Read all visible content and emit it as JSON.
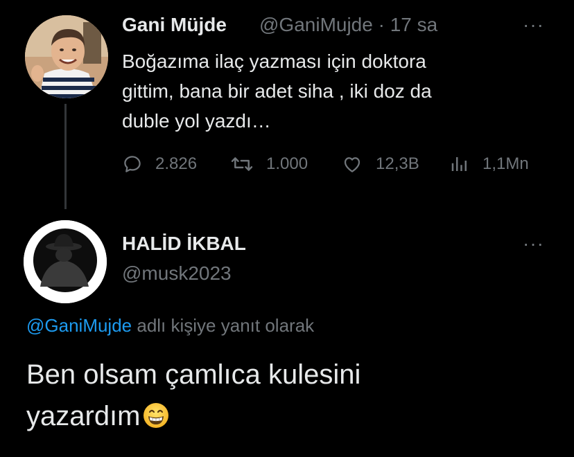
{
  "original_tweet": {
    "display_name": "Gani Müjde",
    "handle": "@GaniMujde",
    "separator": "·",
    "time": "17 sa",
    "text": "Boğazıma ilaç yazması için doktora\ngittim, bana bir adet siha , iki doz da\nduble yol yazdı…",
    "more_label": "···",
    "actions": {
      "replies": "2.826",
      "retweets": "1.000",
      "likes": "12,3B",
      "views": "1,1Mn"
    },
    "icons": [
      "reply-icon",
      "retweet-icon",
      "like-icon",
      "views-icon"
    ]
  },
  "reply_tweet": {
    "display_name": "HALİD İKBAL",
    "handle": "@musk2023",
    "more_label": "···",
    "replying_to_handle": "@GaniMujde",
    "replying_to_suffix": " adlı kişiye yanıt olarak",
    "text": "Ben olsam çamlıca kulesini\nyazardım",
    "emoji": "grinning-face-emoji"
  },
  "colors": {
    "background": "#000000",
    "primary_text": "#e7e9ea",
    "secondary_text": "#71767b",
    "mention": "#1d9bf0",
    "thread_line": "#333639"
  }
}
